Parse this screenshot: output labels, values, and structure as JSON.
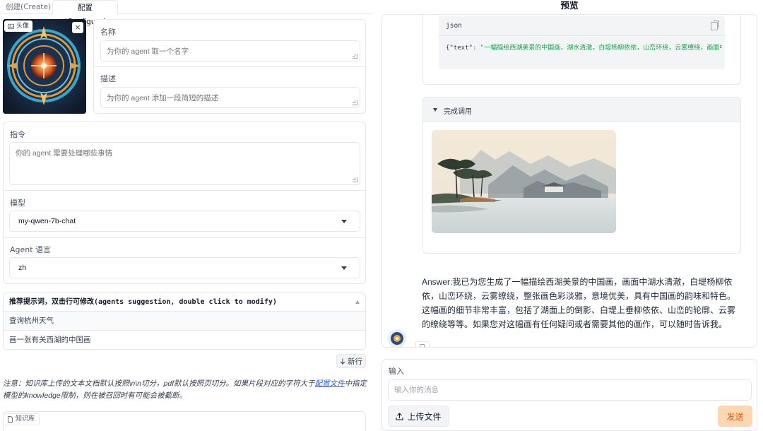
{
  "tabs": [
    {
      "label": "创建(Create)",
      "active": false
    },
    {
      "label": "配置(Configure)",
      "active": true
    }
  ],
  "avatar": {
    "badge_label": "头像",
    "close_glyph": "×"
  },
  "name": {
    "label": "名称",
    "placeholder": "为你的 agent 取一个名字"
  },
  "description": {
    "label": "描述",
    "placeholder": "为你的 agent 添加一段简短的描述"
  },
  "instructions": {
    "label": "指令",
    "placeholder": "你的 agent 需要处理哪些事情"
  },
  "model": {
    "label": "模型",
    "value": "my-qwen-7b-chat"
  },
  "language": {
    "label": "Agent 语言",
    "value": "zh"
  },
  "suggestions": {
    "header": "推荐提示词，双击行可修改(agents suggestion, double click to modify)",
    "rows": [
      "查询杭州天气",
      "画一张有关西湖的中国画"
    ],
    "new_row_label": "新行"
  },
  "note": {
    "before": "注意：知识库上传的文本文档默认按照\\n\\n切分，pdf默认按照页切分。如果片段对应的字符大于",
    "link": "配置文件",
    "after": "中指定模型的knowledge限制，则在被召回时有可能会被截断。"
  },
  "knowledge": {
    "label": "知识库"
  },
  "preview": {
    "title": "预览",
    "code_lang": "json",
    "code_key": "{\"text\"",
    "code_value": ": \"一幅描绘西湖美景的中国画，湖水清澈，白堤杨柳依依，山峦环绕，云雾缭绕，画面中融入",
    "call_label": "完成调用",
    "answer": "Answer:我已为您生成了一幅描绘西湖美景的中国画，画面中湖水清澈，白堤杨柳依依，山峦环绕，云雾缭绕，整张画色彩淡雅，意境优美，具有中国画的韵味和特色。这幅画的细节非常丰富，包括了湖面上的倒影、白堤上垂柳依依、山峦的轮廓、云雾的缭绕等等。如果您对这幅画有任何疑问或者需要其他的画作，可以随时告诉我。"
  },
  "input": {
    "label": "输入",
    "placeholder": "输入你的消息",
    "upload_label": "上传文件",
    "send_label": "发送"
  },
  "colors": {
    "accent": "#ea580c",
    "send_bg": "#fbd7b4",
    "link": "#2563eb",
    "code_string": "#16a34a"
  }
}
